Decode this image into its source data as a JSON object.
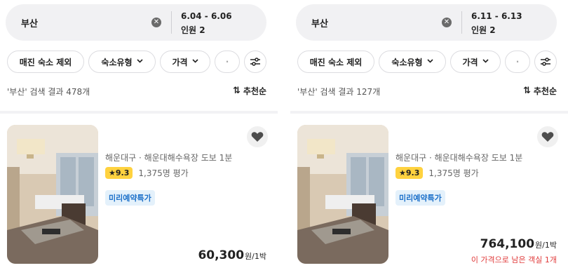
{
  "screens": [
    {
      "search": {
        "place": "부산",
        "dates": "6.04 - 6.06",
        "guests": "인원 2"
      },
      "filters": [
        "매진 숙소 제외",
        "숙소유형",
        "가격",
        "·"
      ],
      "result_text": "'부산' 검색 결과 478개",
      "sort_label": "추천순",
      "listing": {
        "location": "해운대구 · 해운대해수욕장 도보 1분",
        "rating": "9.3",
        "reviews": "1,375명 평가",
        "promo": "미리예약특가",
        "price": "60,300",
        "price_unit": "원/1박",
        "warning": ""
      }
    },
    {
      "search": {
        "place": "부산",
        "dates": "6.11 - 6.13",
        "guests": "인원 2"
      },
      "filters": [
        "매진 숙소 제외",
        "숙소유형",
        "가격",
        "·"
      ],
      "result_text": "'부산' 검색 결과 127개",
      "sort_label": "추천순",
      "listing": {
        "location": "해운대구 · 해운대해수욕장 도보 1분",
        "rating": "9.3",
        "reviews": "1,375명 평가",
        "promo": "미리예약특가",
        "price": "764,100",
        "price_unit": "원/1박",
        "warning": "이 가격으로 남은 객실 1개"
      }
    }
  ],
  "colors": {
    "star_badge": "#ffd23f",
    "promo_bg": "#e4f1fb",
    "promo_text": "#1a6fc9",
    "warning": "#e03b3b"
  },
  "icons": {
    "clear": "clear-icon",
    "filter": "filter-sliders-icon",
    "sort": "sort-arrows-icon",
    "heart": "heart-icon",
    "star": "star-icon",
    "chevron": "chevron-down-icon"
  }
}
